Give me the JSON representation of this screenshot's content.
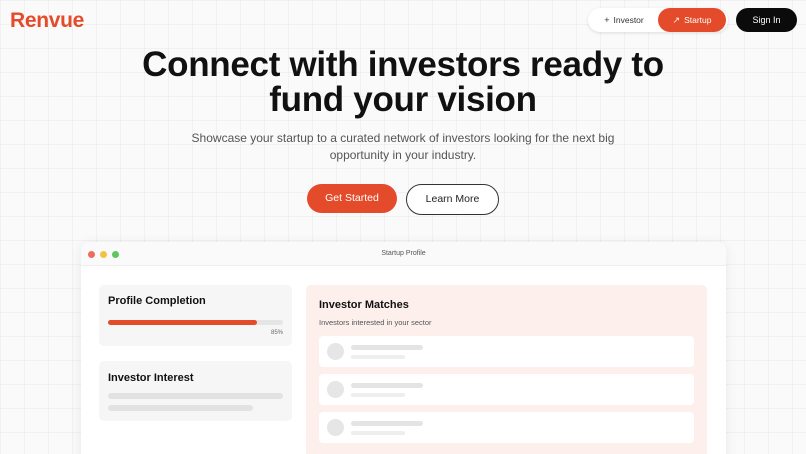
{
  "brand": {
    "name": "Renvue",
    "accent": "#e44b2a"
  },
  "nav": {
    "toggle": {
      "investor": {
        "label": "Investor",
        "icon": "plus-icon"
      },
      "startup": {
        "label": "Startup",
        "icon": "arrow-trend-icon",
        "selected": true
      }
    },
    "signin_label": "Sign In"
  },
  "hero": {
    "headline_line1": "Connect with investors ready to",
    "headline_line2": "fund your vision",
    "subtitle": "Showcase your startup to a curated network of investors looking for the next big opportunity in your industry.",
    "primary_label": "Get Started",
    "secondary_label": "Learn More"
  },
  "preview": {
    "window_title": "Startup Profile",
    "completion": {
      "title": "Profile Completion",
      "percent": 85,
      "percent_label": "85%"
    },
    "interest": {
      "title": "Investor Interest"
    },
    "matches": {
      "title": "Investor Matches",
      "subtitle": "Investors interested in your sector",
      "rows": 3
    }
  }
}
